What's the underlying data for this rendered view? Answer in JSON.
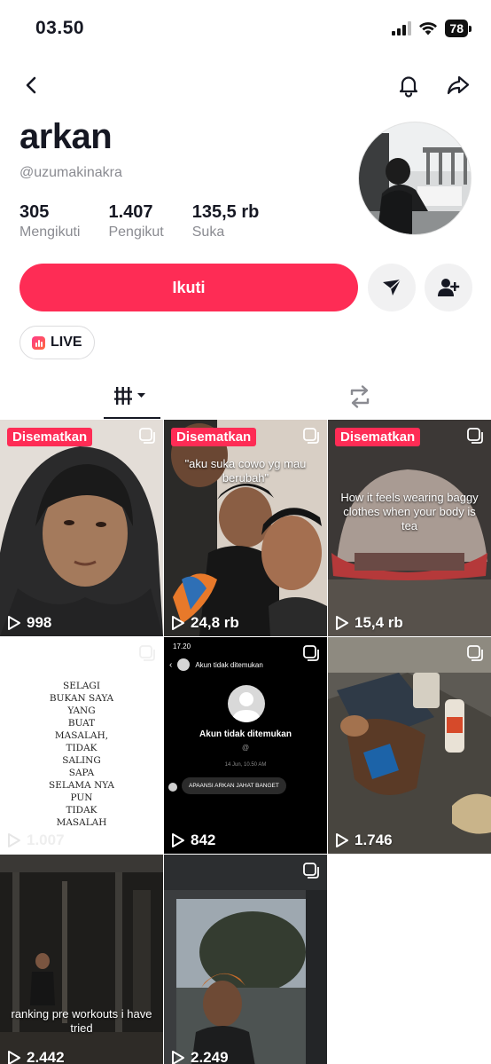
{
  "status": {
    "time": "03.50",
    "battery": "78"
  },
  "profile": {
    "name": "arkan",
    "handle": "@uzumakinakra",
    "stats": [
      {
        "value": "305",
        "label": "Mengikuti"
      },
      {
        "value": "1.407",
        "label": "Pengikut"
      },
      {
        "value": "135,5 rb",
        "label": "Suka"
      }
    ]
  },
  "actions": {
    "follow_label": "Ikuti",
    "live_label": "LIVE"
  },
  "nav": {
    "back_icon": "chevron-left-icon",
    "bell_icon": "bell-icon",
    "share_icon": "share-icon"
  },
  "videos": [
    {
      "pinned_label": "Disematkan",
      "views": "998"
    },
    {
      "pinned_label": "Disematkan",
      "views": "24,8 rb",
      "caption": "\"aku suka cowo yg mau berubah\""
    },
    {
      "pinned_label": "Disematkan",
      "views": "15,4 rb",
      "caption": "How it feels wearing baggy clothes when your body is tea"
    },
    {
      "views": "1.007",
      "poem": [
        "SELAGI",
        "BUKAN SAYA",
        "YANG",
        "BUAT",
        "MASALAH,",
        "TIDAK",
        "SALING",
        "SAPA",
        "SELAMA NYA",
        "PUN",
        "TIDAK",
        "MASALAH"
      ]
    },
    {
      "views": "842",
      "phone": {
        "time": "17.20",
        "header": "Akun tidak ditemukan",
        "title": "Akun tidak ditemukan",
        "at": "@",
        "date": "14 Jun, 10.50 AM",
        "message": "APAANSI ARKAN JAHAT BANGET"
      }
    },
    {
      "views": "1.746"
    },
    {
      "views": "2.442",
      "caption": "ranking pre workouts i have tried"
    },
    {
      "views": "2.249"
    }
  ],
  "colors": {
    "accent": "#fe2c55",
    "text": "#161823",
    "muted": "#8a8b91"
  }
}
